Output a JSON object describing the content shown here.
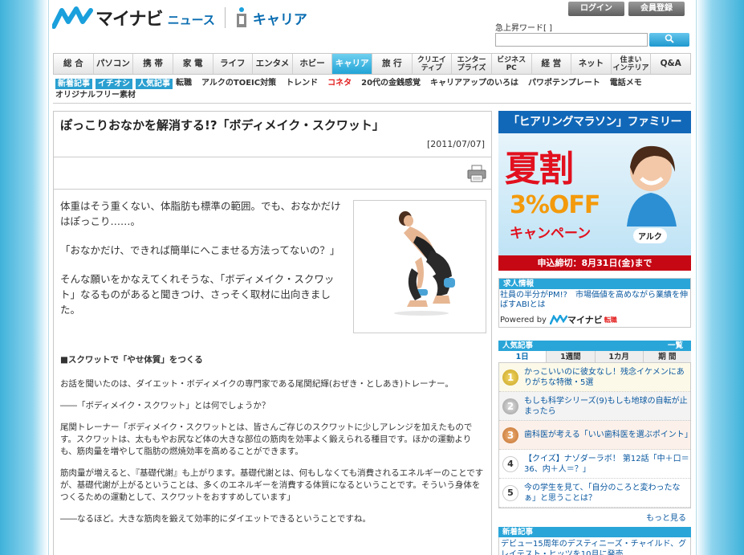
{
  "header": {
    "brand": "マイナビ",
    "brand_sub": "ニュース",
    "section_name": "キャリア",
    "login_label": "ログイン",
    "register_label": "会員登録",
    "trend_label": "急上昇ワード[ ]",
    "search_placeholder": ""
  },
  "nav": {
    "items": [
      {
        "label": "総 合"
      },
      {
        "label": "パソコン"
      },
      {
        "label": "携 帯"
      },
      {
        "label": "家 電"
      },
      {
        "label": "ライフ"
      },
      {
        "label": "エンタメ"
      },
      {
        "label": "ホビー"
      },
      {
        "label": "キャリア"
      },
      {
        "label": "旅 行"
      },
      {
        "label": "クリエイ\nティブ"
      },
      {
        "label": "エンター\nプライズ"
      },
      {
        "label": "ビジネス\nPC"
      },
      {
        "label": "経 営"
      },
      {
        "label": "ネット"
      },
      {
        "label": "住まい\nインテリア"
      },
      {
        "label": "Q&A"
      }
    ],
    "active_index": 7
  },
  "subnav": {
    "tags": [
      "新着記事",
      "イチオシ",
      "人気記事"
    ],
    "row1_links": [
      "転職",
      "アルクのTOEIC対策",
      "トレンド",
      "コネタ",
      "20代の金銭感覚",
      "キャリアアップのいろは",
      "パワポテンプレート",
      "電話メモ"
    ],
    "row1_red_index": 3,
    "row2_links": [
      "オリジナルフリー素材"
    ]
  },
  "article": {
    "title": "ぽっこりおなかを解消する!?「ボディメイク・スクワット」",
    "date": "[2011/07/07]",
    "lead_paragraphs": [
      "体重はそう重くない、体脂肪も標準の範囲。でも、おなかだけはぽっこり……。",
      "「おなかだけ、できれば簡単にへこませる方法ってないの？」",
      "そんな願いをかなえてくれそうな、「ボディメイク・スクワット」なるものがあると聞きつけ、さっそく取材に出向きました。"
    ],
    "heading": "■スクワットで「やせ体質」をつくる",
    "paragraphs": [
      "お話を聞いたのは、ダイエット・ボディメイクの専門家である尾関紀輝(おぜき・としあき)トレーナー。",
      "――「ボディメイク・スクワット」とは何でしょうか？",
      "尾関トレーナー「ボディメイク・スクワットとは、皆さんご存じのスクワットに少しアレンジを加えたものです。スクワットは、太ももやお尻など体の大きな部位の筋肉を効率よく鍛えられる種目です。ほかの運動よりも、筋肉量を増やして脂肪の燃焼効率を高めることができます。",
      "筋肉量が増えると、『基礎代謝』も上がります。基礎代謝とは、何もしなくても消費されるエネルギーのことですが、基礎代謝が上がるということは、多くのエネルギーを消費する体質になるということです。そういう身体をつくるための運動として、スクワットをおすすめしています」",
      "――なるほど。大きな筋肉を鍛えて効率的にダイエットできるということですね。"
    ]
  },
  "ad": {
    "top": "「ヒアリングマラソン」ファミリー",
    "big": "夏割",
    "off": "3%OFF",
    "campaign": "キャンペーン",
    "brand": "アルク",
    "bottom": "申込締切：8月31日(金)まで"
  },
  "job": {
    "head": "求人情報",
    "text": "社員の半分がPM!?　市場価値を高めながら業績を伸ばすABIとは",
    "powered": "Powered by",
    "powered_brand": "マイナビ",
    "powered_sub": "転職"
  },
  "popular": {
    "head": "人気記事",
    "list_link": "一覧",
    "tabs": [
      "1日",
      "1週間",
      "1カ月",
      "期 間"
    ],
    "items": [
      {
        "rank": "1",
        "text": "かっこいいのに彼女なし！残念イケメンにありがちな特徴・5選"
      },
      {
        "rank": "2",
        "text": "もしも科学シリーズ(9)もしも地球の自転が止まったら"
      },
      {
        "rank": "3",
        "text": "歯科医が考える「いい歯科医を選ぶポイント」"
      },
      {
        "rank": "4",
        "text": "【クイズ】ナゾダーラボ！ 第12話「中＋口＝36、内＋人＝？」"
      },
      {
        "rank": "5",
        "text": "今の学生を見て、「自分のころと変わったなぁ」と思うことは？"
      }
    ],
    "more": "もっと見る"
  },
  "news": {
    "head": "新着記事",
    "text": "デビュー15周年のデスティニーズ・チャイルド、グレイテスト・ヒッツを10月に発売"
  },
  "colors": {
    "accent": "#22a4d6",
    "brand_blue": "#0a6db1",
    "red": "#e31b1b"
  }
}
